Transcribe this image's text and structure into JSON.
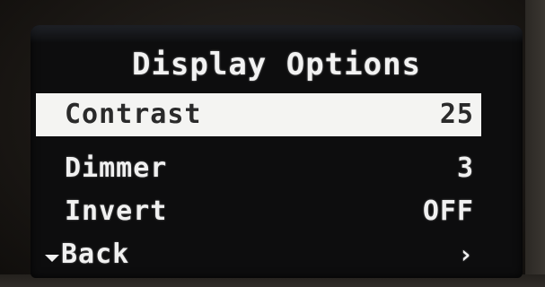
{
  "screen": {
    "title": "Display Options",
    "items": [
      {
        "label": "Contrast",
        "value": "25",
        "selected": true
      },
      {
        "label": "Dimmer",
        "value": "3",
        "selected": false
      },
      {
        "label": "Invert",
        "value": "OFF",
        "selected": false
      }
    ],
    "back": {
      "label": "Back",
      "down_icon": "triangle-down-icon",
      "next_icon": "chevron-right-icon",
      "next_glyph": "›"
    }
  },
  "colors": {
    "screen_bg": "#0d0d0e",
    "text": "#f0f0f0",
    "highlight_bg": "#f4f4f2",
    "highlight_text": "#2a2a2a"
  }
}
